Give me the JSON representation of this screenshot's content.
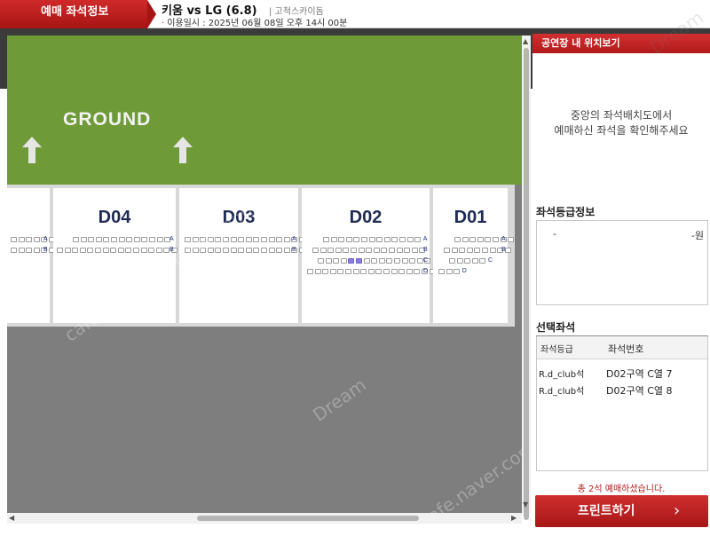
{
  "header": {
    "tab_label": "예매 좌석정보",
    "game_title": "키움 vs LG (6.8)",
    "venue": "| 고척스카이돔",
    "usage_bullet": "·",
    "usage_date": "이용일시 : 2025년 06월 08일 오후 14시 00분"
  },
  "map": {
    "ground_label": "GROUND",
    "blocks": [
      {
        "title": "",
        "rows": [
          {
            "label": "A",
            "seats": 6
          },
          {
            "label": "B",
            "seats": 6
          }
        ]
      },
      {
        "title": "D04",
        "rows": [
          {
            "label": "A",
            "seats": 13
          },
          {
            "label": "B",
            "seats": 17
          }
        ]
      },
      {
        "title": "D03",
        "rows": [
          {
            "label": "A",
            "seats": 17
          },
          {
            "label": "B",
            "seats": 17
          }
        ]
      },
      {
        "title": "D02",
        "rows": [
          {
            "label": "A",
            "seats": 13
          },
          {
            "label": "B",
            "seats": 15
          },
          {
            "label": "C",
            "seats": 15
          },
          {
            "label": "D",
            "seats": 17
          }
        ]
      },
      {
        "title": "D01",
        "rows": [
          {
            "label": "A",
            "seats": 8
          },
          {
            "label": "B",
            "seats": 9
          },
          {
            "label": "C",
            "seats": 5
          },
          {
            "label": "D",
            "seats": 3
          }
        ]
      }
    ],
    "selected_seats": [
      7,
      8
    ]
  },
  "right": {
    "location_header": "공연장 내 위치보기",
    "location_text_1": "중앙의 좌석배치도에서",
    "location_text_2": "예매하신 좌석을 확인해주세요",
    "grade_title": "좌석등급정보",
    "grade_name": "-",
    "grade_price": "-원",
    "selected_title": "선택좌석",
    "col_grade": "좌석등급",
    "col_seat": "좌석번호",
    "selected": [
      {
        "grade": "R.d_club석",
        "seat": "D02구역 C열 7"
      },
      {
        "grade": "R.d_club석",
        "seat": "D02구역 C열 8"
      }
    ],
    "total_text": "총 2석 예매하셨습니다.",
    "print_label": "프린트하기",
    "print_arrow": "›"
  },
  "scroll": {
    "up": "▲",
    "down": "▼",
    "left": "◀",
    "right": "▶"
  },
  "watermarks": [
    "cafe.naver.com/joonggonara",
    "Dream"
  ],
  "colors": {
    "accent": "#b01a1a",
    "ground": "#6f9a38",
    "selected_seat": "#8a7fe0",
    "block_title": "#1f2a55"
  }
}
